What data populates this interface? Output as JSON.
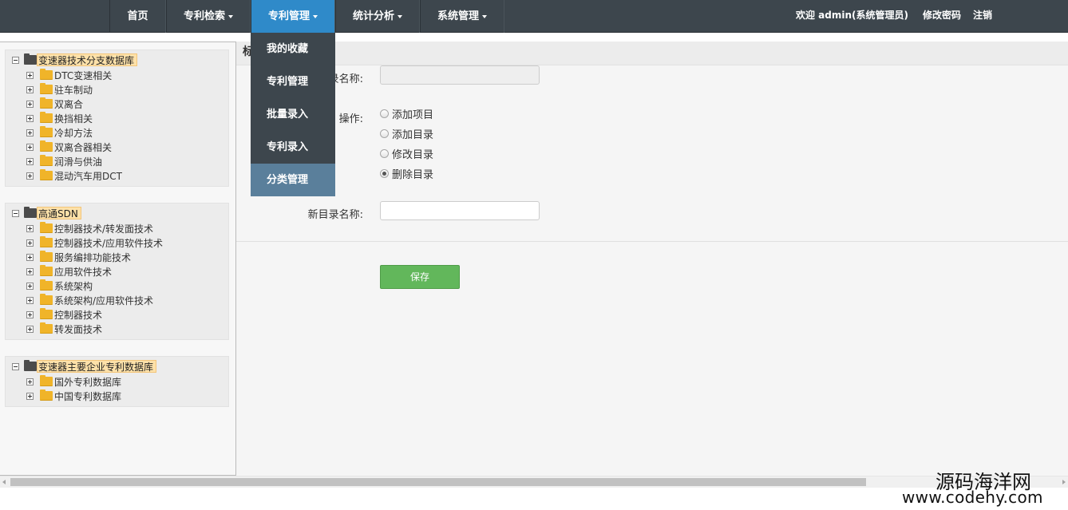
{
  "nav": {
    "items": [
      {
        "label": "首页",
        "has_caret": false
      },
      {
        "label": "专利检索",
        "has_caret": true
      },
      {
        "label": "专利管理",
        "has_caret": true
      },
      {
        "label": "统计分析",
        "has_caret": true
      },
      {
        "label": "系统管理",
        "has_caret": true
      }
    ],
    "active": "专利管理",
    "welcome": "欢迎 admin(系统管理员)",
    "change_password": "修改密码",
    "logout": "注销"
  },
  "dropdown": {
    "items": [
      "我的收藏",
      "专利管理",
      "批量录入",
      "专利录入",
      "分类管理"
    ],
    "active": "分类管理"
  },
  "trees": [
    {
      "root": "变速器技术分支数据库",
      "children": [
        "DTC变速相关",
        "驻车制动",
        "双离合",
        "换挡相关",
        "冷却方法",
        "双离合器相关",
        "润滑与供油",
        "混动汽车用DCT"
      ]
    },
    {
      "root": "高通SDN",
      "children": [
        "控制器技术/转发面技术",
        "控制器技术/应用软件技术",
        "服务编排功能技术",
        "应用软件技术",
        "系统架构",
        "系统架构/应用软件技术",
        "控制器技术",
        "转发面技术"
      ]
    },
    {
      "root": "变速器主要企业专利数据库",
      "children": [
        "国外专利数据库",
        "中国专利数据库"
      ]
    }
  ],
  "main": {
    "title": "标",
    "name_label": "录名称:",
    "name_value": "",
    "operation_label": "操作:",
    "operations": [
      "添加项目",
      "添加目录",
      "修改目录",
      "删除目录"
    ],
    "selected_operation": "删除目录",
    "new_name_label": "新目录名称:",
    "new_name_value": "",
    "save_label": "保存"
  },
  "watermark": {
    "cn": "源码海洋网",
    "url": "www.codehy.com"
  },
  "colors": {
    "topbar_bg": "#3d464d",
    "nav_active": "#2f8ac9",
    "dropdown_active": "#5a7f9b",
    "save_button": "#62b75b"
  }
}
